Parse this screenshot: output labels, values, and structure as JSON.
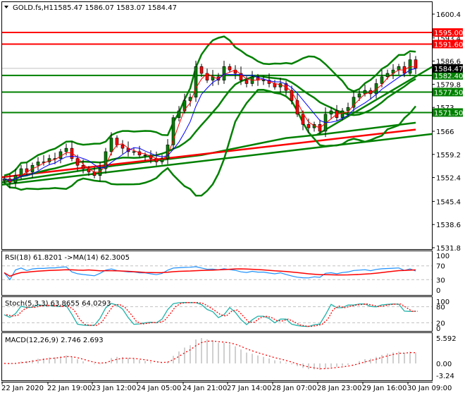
{
  "header": {
    "symbol": "GOLD.fs,H1",
    "ohlc": "1585.47 1586.07 1583.07 1584.47"
  },
  "colors": {
    "up": "#008000",
    "down": "#ff0000",
    "level_red": "#ff0000",
    "level_green": "#008000",
    "ma_fast": "#ff0000",
    "ma_slow": "#0000ff",
    "bands": "#008000",
    "rsi": "#1e90ff",
    "stoch_main": "#20b2aa",
    "macd_hist": "#c0c0c0"
  },
  "chart_data": {
    "type": "candlestick",
    "title": "GOLD.fs,H1",
    "price_axis": {
      "ticks": [
        1600.4,
        1593.4,
        1586.6,
        1579.8,
        1573.0,
        1566.0,
        1559.2,
        1552.4,
        1545.4,
        1538.6,
        1531.8
      ],
      "range": [
        1531.8,
        1600.4
      ]
    },
    "time_axis": [
      "22 Jan 2020",
      "22 Jan 19:00",
      "23 Jan 12:00",
      "24 Jan 05:00",
      "24 Jan 21:00",
      "27 Jan 14:00",
      "28 Jan 07:00",
      "28 Jan 23:00",
      "29 Jan 16:00",
      "30 Jan 09:00"
    ],
    "closes": [
      1552,
      1551,
      1553,
      1555,
      1554,
      1556,
      1557,
      1557,
      1558,
      1558,
      1560,
      1561,
      1558,
      1556,
      1555,
      1554,
      1553,
      1555,
      1560,
      1564,
      1562,
      1561,
      1560,
      1560,
      1559,
      1559,
      1558,
      1557,
      1558,
      1562,
      1570,
      1572,
      1575,
      1576,
      1585,
      1583,
      1581,
      1582,
      1581,
      1585,
      1584,
      1583,
      1581,
      1580,
      1582,
      1581,
      1581,
      1580,
      1579,
      1580,
      1578,
      1575,
      1571,
      1568,
      1567,
      1568,
      1566,
      1571,
      1572,
      1570,
      1572,
      1573,
      1576,
      1577,
      1578,
      1577,
      1580,
      1582,
      1583,
      1584,
      1585,
      1583,
      1587,
      1584.47
    ],
    "current_price": "1584.47",
    "levels": [
      {
        "price": 1595.0,
        "label": "1595.00",
        "color": "red"
      },
      {
        "price": 1591.6,
        "label": "1591.60",
        "color": "red"
      },
      {
        "price": 1582.4,
        "label": "1582.40",
        "color": "green"
      },
      {
        "price": 1577.5,
        "label": "1577.50",
        "color": "green"
      },
      {
        "price": 1571.5,
        "label": "1571.50",
        "color": "green"
      }
    ],
    "trendlines": [
      {
        "from": [
          -0.4,
          1550.3
        ],
        "to": [
          75.9,
          1565.2
        ]
      },
      {
        "from": [
          55.5,
          1565.0
        ],
        "to": [
          75.9,
          1584.9
        ]
      }
    ],
    "ma200": [
      [
        -0.4,
        1552.5
      ],
      [
        73,
        1566.5
      ]
    ],
    "slow_ma": [
      [
        -0.4,
        1551
      ],
      [
        20,
        1556
      ],
      [
        35,
        1559
      ],
      [
        50,
        1564
      ],
      [
        56,
        1565
      ],
      [
        73,
        1568.5
      ]
    ],
    "indicators": {
      "rsi": {
        "label": "RSI(18) 61.8201  ->MA(14) 62.3005",
        "ticks": [
          "100",
          "70",
          "30",
          "0"
        ],
        "levels": [
          70,
          30
        ]
      },
      "stoch": {
        "label": "Stoch(5,3,3) 63.8655 64.0293",
        "ticks": [
          "100",
          "80",
          "20",
          "0"
        ],
        "levels": [
          80,
          20
        ]
      },
      "macd": {
        "label": "MACD(12,26,9) 2.746 2.693",
        "ticks": [
          "5.592",
          "0.00",
          "-3.24"
        ],
        "range": [
          -3.24,
          5.592
        ]
      }
    }
  }
}
